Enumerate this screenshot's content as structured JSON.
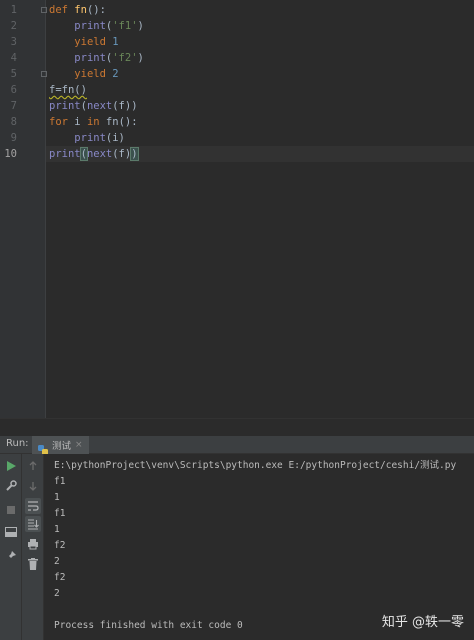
{
  "editor": {
    "line_numbers": [
      "1",
      "2",
      "3",
      "4",
      "5",
      "6",
      "7",
      "8",
      "9",
      "10"
    ],
    "lines": [
      [
        {
          "t": "def ",
          "c": "kw"
        },
        {
          "t": "fn",
          "c": "fn"
        },
        {
          "t": "():",
          "c": ""
        }
      ],
      [
        {
          "t": "    ",
          "c": ""
        },
        {
          "t": "print",
          "c": "bi"
        },
        {
          "t": "(",
          "c": ""
        },
        {
          "t": "'f1'",
          "c": "str"
        },
        {
          "t": ")",
          "c": ""
        }
      ],
      [
        {
          "t": "    ",
          "c": ""
        },
        {
          "t": "yield ",
          "c": "kw"
        },
        {
          "t": "1",
          "c": "num"
        }
      ],
      [
        {
          "t": "    ",
          "c": ""
        },
        {
          "t": "print",
          "c": "bi"
        },
        {
          "t": "(",
          "c": ""
        },
        {
          "t": "'f2'",
          "c": "str"
        },
        {
          "t": ")",
          "c": ""
        }
      ],
      [
        {
          "t": "    ",
          "c": ""
        },
        {
          "t": "yield ",
          "c": "kw"
        },
        {
          "t": "2",
          "c": "num"
        }
      ],
      [
        {
          "t": "f=fn()",
          "c": "warn"
        }
      ],
      [
        {
          "t": "print",
          "c": "bi"
        },
        {
          "t": "(",
          "c": ""
        },
        {
          "t": "next",
          "c": "bi"
        },
        {
          "t": "(f))",
          "c": ""
        }
      ],
      [
        {
          "t": "for ",
          "c": "kw"
        },
        {
          "t": "i ",
          "c": ""
        },
        {
          "t": "in ",
          "c": "kw"
        },
        {
          "t": "fn():",
          "c": ""
        }
      ],
      [
        {
          "t": "    ",
          "c": ""
        },
        {
          "t": "print",
          "c": "bi"
        },
        {
          "t": "(i)",
          "c": ""
        }
      ],
      [
        {
          "t": "print",
          "c": "bi"
        },
        {
          "t": "(",
          "c": "br"
        },
        {
          "t": "next",
          "c": "bi"
        },
        {
          "t": "(f)",
          "c": ""
        },
        {
          "t": ")",
          "c": "br"
        },
        {
          "t": "",
          "c": "caret"
        }
      ]
    ],
    "current_line": 10
  },
  "run": {
    "label": "Run:",
    "tab_name": "测试",
    "tab_close": "×"
  },
  "console": {
    "lines": [
      "E:\\pythonProject\\venv\\Scripts\\python.exe E:/pythonProject/ceshi/测试.py",
      "f1",
      "1",
      "f1",
      "1",
      "f2",
      "2",
      "f2",
      "2",
      "",
      "Process finished with exit code 0"
    ]
  },
  "watermark": "知乎 @轶一零",
  "toolbar_left": [
    "run-icon",
    "wrench-icon",
    "stop-icon",
    "layout-icon",
    "pin-icon"
  ],
  "toolbar_right": [
    "up-arrow-icon",
    "down-arrow-icon",
    "soft-wrap-icon",
    "scroll-to-end-icon",
    "print-icon",
    "trash-icon"
  ]
}
